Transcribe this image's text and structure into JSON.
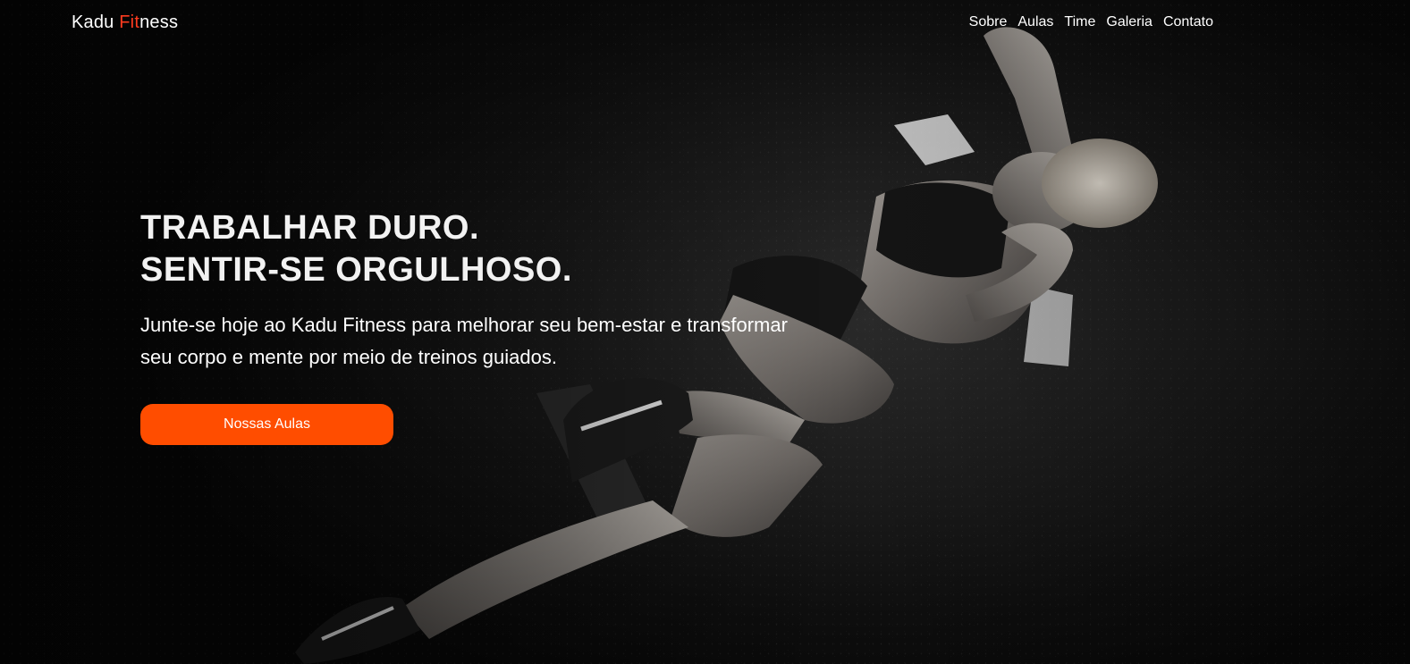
{
  "header": {
    "logo_prefix": "Kadu ",
    "logo_accent": "Fit",
    "logo_suffix": "ness",
    "nav": [
      "Sobre",
      "Aulas",
      "Time",
      "Galeria",
      "Contato"
    ]
  },
  "hero": {
    "headline_line1": "TRABALHAR DURO.",
    "headline_line2": "SENTIR-SE ORGULHOSO.",
    "lead": "Junte-se hoje ao Kadu Fitness para melhorar seu bem-estar e transformar seu corpo e mente por meio de treinos guiados.",
    "cta_label": "Nossas Aulas",
    "background_image": "athlete-doing-situps-photo"
  },
  "colors": {
    "accent": "#ff3b1f",
    "button": "#ff4d00",
    "background": "#0b0b0b",
    "text": "#ffffff"
  }
}
